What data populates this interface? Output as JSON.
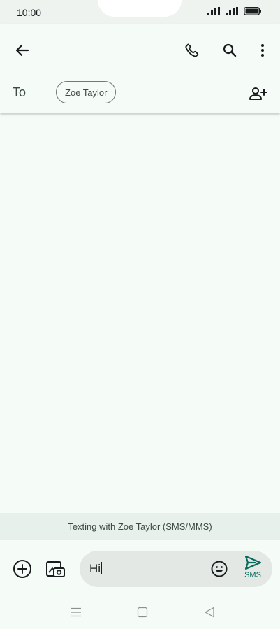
{
  "status": {
    "time": "10:00"
  },
  "header": {
    "to_label": "To",
    "recipient_chip": "Zoe Taylor"
  },
  "info_bar": {
    "text": "Texting with Zoe Taylor (SMS/MMS)"
  },
  "composer": {
    "input_value": "Hi",
    "send_label": "SMS"
  },
  "colors": {
    "background": "#f5fbf7",
    "info_bar": "#e8f0ec",
    "input_bg": "#e3e8e5",
    "send_accent": "#0a6b5c"
  },
  "icons": [
    "back-arrow-icon",
    "phone-icon",
    "search-icon",
    "more-vert-icon",
    "add-person-icon",
    "add-circle-icon",
    "gallery-camera-icon",
    "emoji-icon",
    "send-icon",
    "menu-icon",
    "home-square-icon",
    "back-triangle-icon"
  ]
}
